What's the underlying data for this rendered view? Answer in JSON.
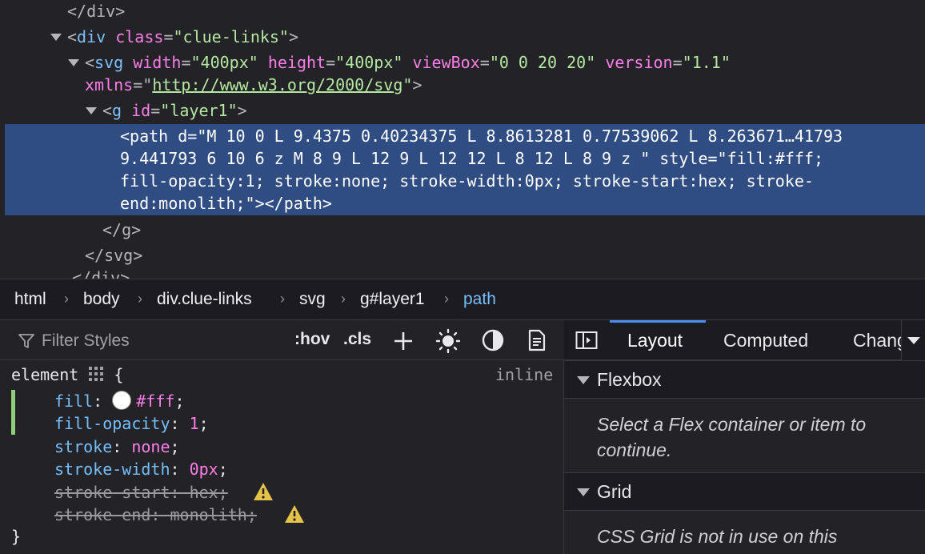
{
  "markup": {
    "line0": {
      "close": "</div>"
    },
    "div_line": {
      "tag": "div",
      "attr": "class",
      "val": "\"clue-links\""
    },
    "svg_line": {
      "tag": "svg",
      "a1": "width",
      "v1": "\"400px\"",
      "a2": "height",
      "v2": "\"400px\"",
      "a3": "viewBox",
      "v3": "\"0 0 20 20\"",
      "a4": "version",
      "v4": "\"1.1\"",
      "a5": "xmlns",
      "v5": "http://www.w3.org/2000/svg"
    },
    "g_line": {
      "tag": "g",
      "attr": "id",
      "val": "\"layer1\""
    },
    "selected": {
      "l1": "<path d=\"M 10 0 L 9.4375 0.40234375 L 8.8613281 0.77539062 L 8.263671…41793",
      "l2": "9.441793 6 10 6 z M 8 9 L 12 9 L 12 12 L 8 12 L 8 9 z \" style=\"fill:#fff;",
      "l3": "fill-opacity:1; stroke:none; stroke-width:0px; stroke-start:hex; stroke-",
      "l4": "end:monolith;\"></path>"
    },
    "close_g": "</g>",
    "close_svg": "</svg>",
    "close_div": "</div>"
  },
  "breadcrumbs": [
    "html",
    "body",
    "div.clue-links",
    "svg",
    "g#layer1",
    "path"
  ],
  "rules_toolbar": {
    "filter_placeholder": "Filter Styles",
    "hov": ":hov",
    "cls": ".cls",
    "icons": [
      "filter-icon",
      "add-rule-icon",
      "light-theme-icon",
      "dark-theme-icon",
      "print-icon"
    ]
  },
  "rule": {
    "selector": "element",
    "open": "{",
    "close": "}",
    "origin": "inline",
    "declarations": [
      {
        "name": "fill",
        "value": "#fff",
        "swatch": "#ffffff",
        "changed": true,
        "invalid": false
      },
      {
        "name": "fill-opacity",
        "value": "1",
        "changed": true,
        "invalid": false
      },
      {
        "name": "stroke",
        "value": "none",
        "changed": false,
        "invalid": false
      },
      {
        "name": "stroke-width",
        "value": "0px",
        "changed": false,
        "invalid": false
      },
      {
        "name": "stroke-start",
        "value": "hex",
        "changed": false,
        "invalid": true
      },
      {
        "name": "stroke-end",
        "value": "monolith",
        "changed": false,
        "invalid": true
      }
    ]
  },
  "sidebar": {
    "tabs": [
      "Layout",
      "Computed",
      "Changes"
    ],
    "active_tab": "Layout",
    "flexbox": {
      "title": "Flexbox",
      "message": "Select a Flex container or item to continue."
    },
    "grid": {
      "title": "Grid",
      "message": "CSS Grid is not in use on this"
    }
  },
  "colors": {
    "selection": "#2f4d82",
    "tag": "#7cc0ff",
    "attribute": "#ff7de9",
    "value": "#b4e8a0",
    "tab_indicator": "#4a8ff0",
    "changed_bar": "#8ed07a",
    "warning": "#e5c24a"
  }
}
